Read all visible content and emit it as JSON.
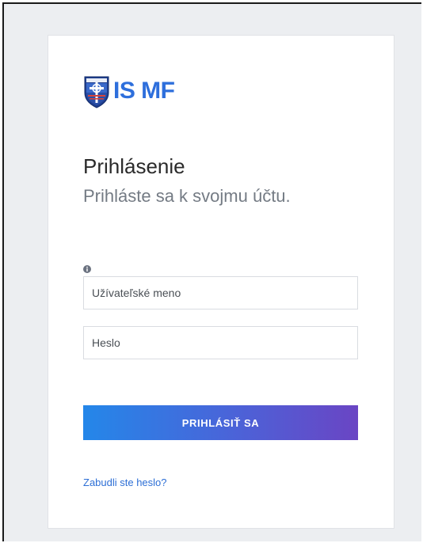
{
  "brand": {
    "name": "IS MF"
  },
  "login": {
    "title": "Prihlásenie",
    "subtitle": "Prihláste sa k svojmu účtu.",
    "username_placeholder": "Užívateľské meno",
    "password_placeholder": "Heslo",
    "submit_label": "PRIHLÁSIŤ SA",
    "forgot_link": "Zabudli ste heslo?"
  },
  "icons": {
    "logo": "shield-crest-icon",
    "info": "info-circle-icon"
  },
  "colors": {
    "brand_blue": "#2e6fdc",
    "button_gradient_start": "#2487e9",
    "button_gradient_end": "#6a45c4",
    "link": "#2d6fd6",
    "page_background": "#eceef1"
  }
}
